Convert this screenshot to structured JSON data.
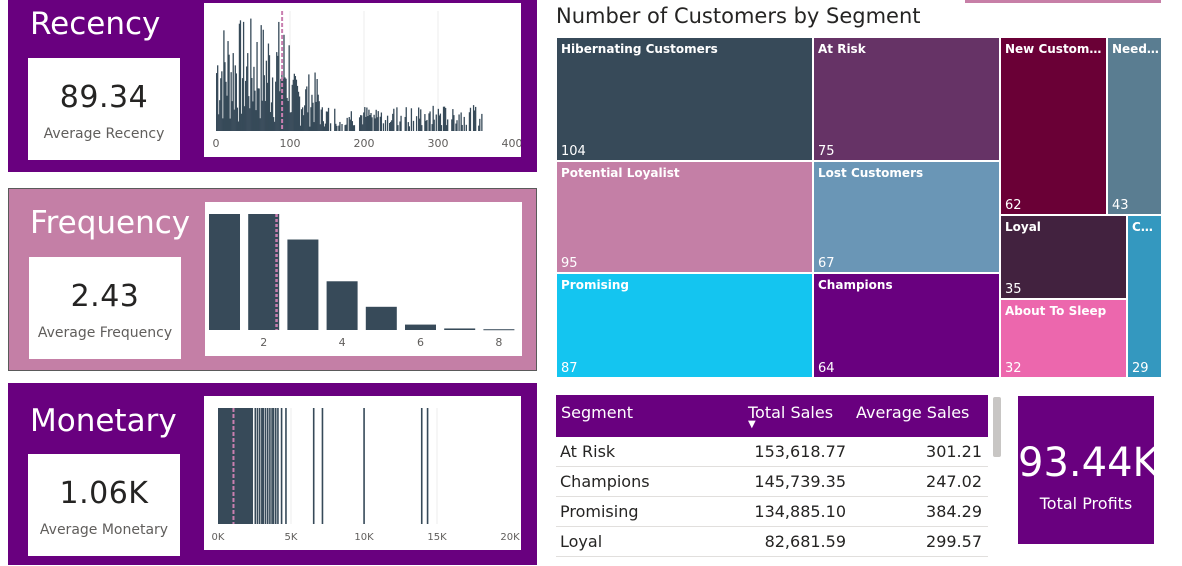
{
  "colors": {
    "purple": "#69007f",
    "pink": "#c47fa6",
    "bar": "#374a59",
    "mean_line": "#c97fb0"
  },
  "recency": {
    "title": "Recency",
    "kpi_value": "89.34",
    "kpi_label": "Average Recency",
    "mean": 89.34,
    "xlim": [
      0,
      400
    ],
    "ticks": [
      "0",
      "100",
      "200",
      "300",
      "400"
    ]
  },
  "frequency": {
    "title": "Frequency",
    "kpi_value": "2.43",
    "kpi_label": "Average Frequency",
    "mean": 2.43,
    "ticks": [
      "2",
      "4",
      "6",
      "8"
    ]
  },
  "monetary": {
    "title": "Monetary",
    "kpi_value": "1.06K",
    "kpi_label": "Average Monetary",
    "mean": 1060,
    "xlim": [
      0,
      20000
    ],
    "ticks": [
      "0K",
      "5K",
      "10K",
      "15K",
      "20K"
    ]
  },
  "treemap": {
    "title": "Number of Customers by Segment"
  },
  "table": {
    "headers": {
      "segment": "Segment",
      "total_sales": "Total Sales",
      "avg_sales": "Average Sales"
    },
    "sort_indicator": "▼",
    "rows": [
      {
        "segment": "At Risk",
        "total": "153,618.77",
        "avg": "301.21"
      },
      {
        "segment": "Champions",
        "total": "145,739.35",
        "avg": "247.02"
      },
      {
        "segment": "Promising",
        "total": "134,885.10",
        "avg": "384.29"
      },
      {
        "segment": "Loyal",
        "total": "82,681.59",
        "avg": "299.57"
      }
    ]
  },
  "profit": {
    "value": "93.44K",
    "label": "Total Profits"
  },
  "chart_data": [
    {
      "type": "bar",
      "title": "",
      "xlabel": "",
      "ylabel": "",
      "categories": [
        1,
        2,
        3,
        4,
        5,
        6,
        7,
        8
      ],
      "values": [
        150,
        150,
        117,
        63,
        30,
        7,
        2,
        1
      ],
      "xticks": [
        2,
        4,
        6,
        8
      ],
      "mean_line": 2.43,
      "grid": false
    },
    {
      "type": "bar",
      "title": "",
      "xlabel": "",
      "ylabel": "",
      "xlim": [
        0,
        400
      ],
      "xticks": [
        0,
        100,
        200,
        300,
        400
      ],
      "mean_line": 89.34,
      "note_values_estimated": true
    },
    {
      "type": "bar",
      "title": "",
      "xlabel": "",
      "ylabel": "",
      "xlim": [
        0,
        20000
      ],
      "xticks": [
        "0K",
        "5K",
        "10K",
        "15K",
        "20K"
      ],
      "mean_line": 1060
    },
    {
      "type": "treemap",
      "title": "Number of Customers by Segment",
      "categories": [
        "Hibernating Customers",
        "At Risk",
        "New Customers",
        "Need Atte...",
        "Potential Loyalist",
        "Lost Customers",
        "Loyal",
        "Canno...",
        "Promising",
        "Champions",
        "About To Sleep"
      ],
      "values": [
        104,
        75,
        62,
        43,
        95,
        67,
        35,
        29,
        87,
        64,
        32
      ]
    }
  ]
}
